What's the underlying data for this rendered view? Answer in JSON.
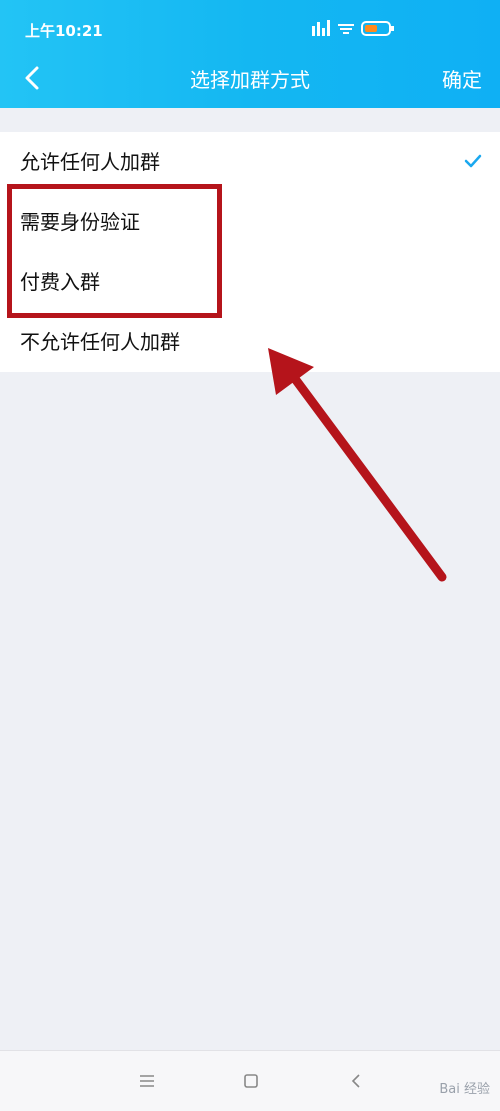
{
  "status_bar": {
    "time": "上午10:21"
  },
  "header": {
    "title": "选择加群方式",
    "confirm_label": "确定"
  },
  "options": [
    {
      "label": "允许任何人加群",
      "selected": true
    },
    {
      "label": "需要身份验证",
      "selected": false
    },
    {
      "label": "付费入群",
      "selected": false
    },
    {
      "label": "不允许任何人加群",
      "selected": false
    }
  ],
  "colors": {
    "header": "#14b7f2",
    "check": "#1aa8ef",
    "annotation": "#b5141b"
  },
  "watermark": "Bai 经验"
}
